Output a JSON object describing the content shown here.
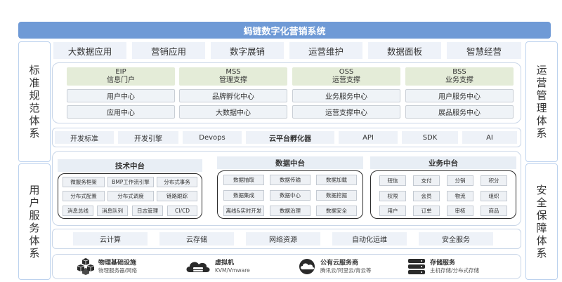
{
  "title": "蚂链数字化营销系统",
  "left_column": [
    "标准规范体系",
    "用户服务体系"
  ],
  "right_column": [
    "运营管理体系",
    "安全保障体系"
  ],
  "apps": [
    "大数据应用",
    "营销应用",
    "数字展销",
    "运营维护",
    "数据面板",
    "智慧经营"
  ],
  "supports": [
    {
      "title": "EIP",
      "subtitle": "信息门户",
      "items": [
        "用户中心",
        "应用中心"
      ]
    },
    {
      "title": "MSS",
      "subtitle": "管理支撑",
      "items": [
        "品牌孵化中心",
        "大数据中心"
      ]
    },
    {
      "title": "OSS",
      "subtitle": "运营支撑",
      "items": [
        "业务服务中心",
        "运营支撑中心"
      ]
    },
    {
      "title": "BSS",
      "subtitle": "业务支撑",
      "items": [
        "用户服务中心",
        "展品服务中心"
      ]
    }
  ],
  "cloud_bar": [
    "开发标准",
    "开发引擎",
    "Devops",
    "云平台孵化器",
    "API",
    "SDK",
    "AI"
  ],
  "platforms": [
    {
      "name": "技术中台",
      "chips": [
        "微服务框架",
        "BMP工作流引擎",
        "分布式事务",
        "分布式配置",
        "分布式调度",
        "链路跟踪",
        "消息总线",
        "消息队列",
        "日志管理",
        "CI/CD"
      ]
    },
    {
      "name": "数据中台",
      "chips": [
        "数据抽取",
        "数据传输",
        "数据加载",
        "数据集成",
        "数据中心",
        "数据挖掘",
        "离线&实时开发",
        "数据治理",
        "数据安全"
      ]
    },
    {
      "name": "业务中台",
      "chips": [
        "短信",
        "支付",
        "分销",
        "积分",
        "权限",
        "会员",
        "物流",
        "组织",
        "用户",
        "订单",
        "审核",
        "商品"
      ]
    }
  ],
  "infra_bar": [
    "云计算",
    "云存储",
    "网络资源",
    "自动化运维",
    "安全服务"
  ],
  "bottom": [
    {
      "title": "物理基础设施",
      "subtitle": "物理服务器/网络",
      "icon": "cubes-icon"
    },
    {
      "title": "虚拟机",
      "subtitle": "KVM/Vmware",
      "icon": "cloud-server-icon"
    },
    {
      "title": "公有云服务商",
      "subtitle": "腾讯云/阿里云/青云等",
      "icon": "cloud-icon"
    },
    {
      "title": "存储服务",
      "subtitle": "主机存储/分布式存储",
      "icon": "database-icon"
    }
  ],
  "colors": {
    "title_bar": "#6f9ad6",
    "border": "#c9d6e8",
    "head_box": "#e4ecd8"
  }
}
